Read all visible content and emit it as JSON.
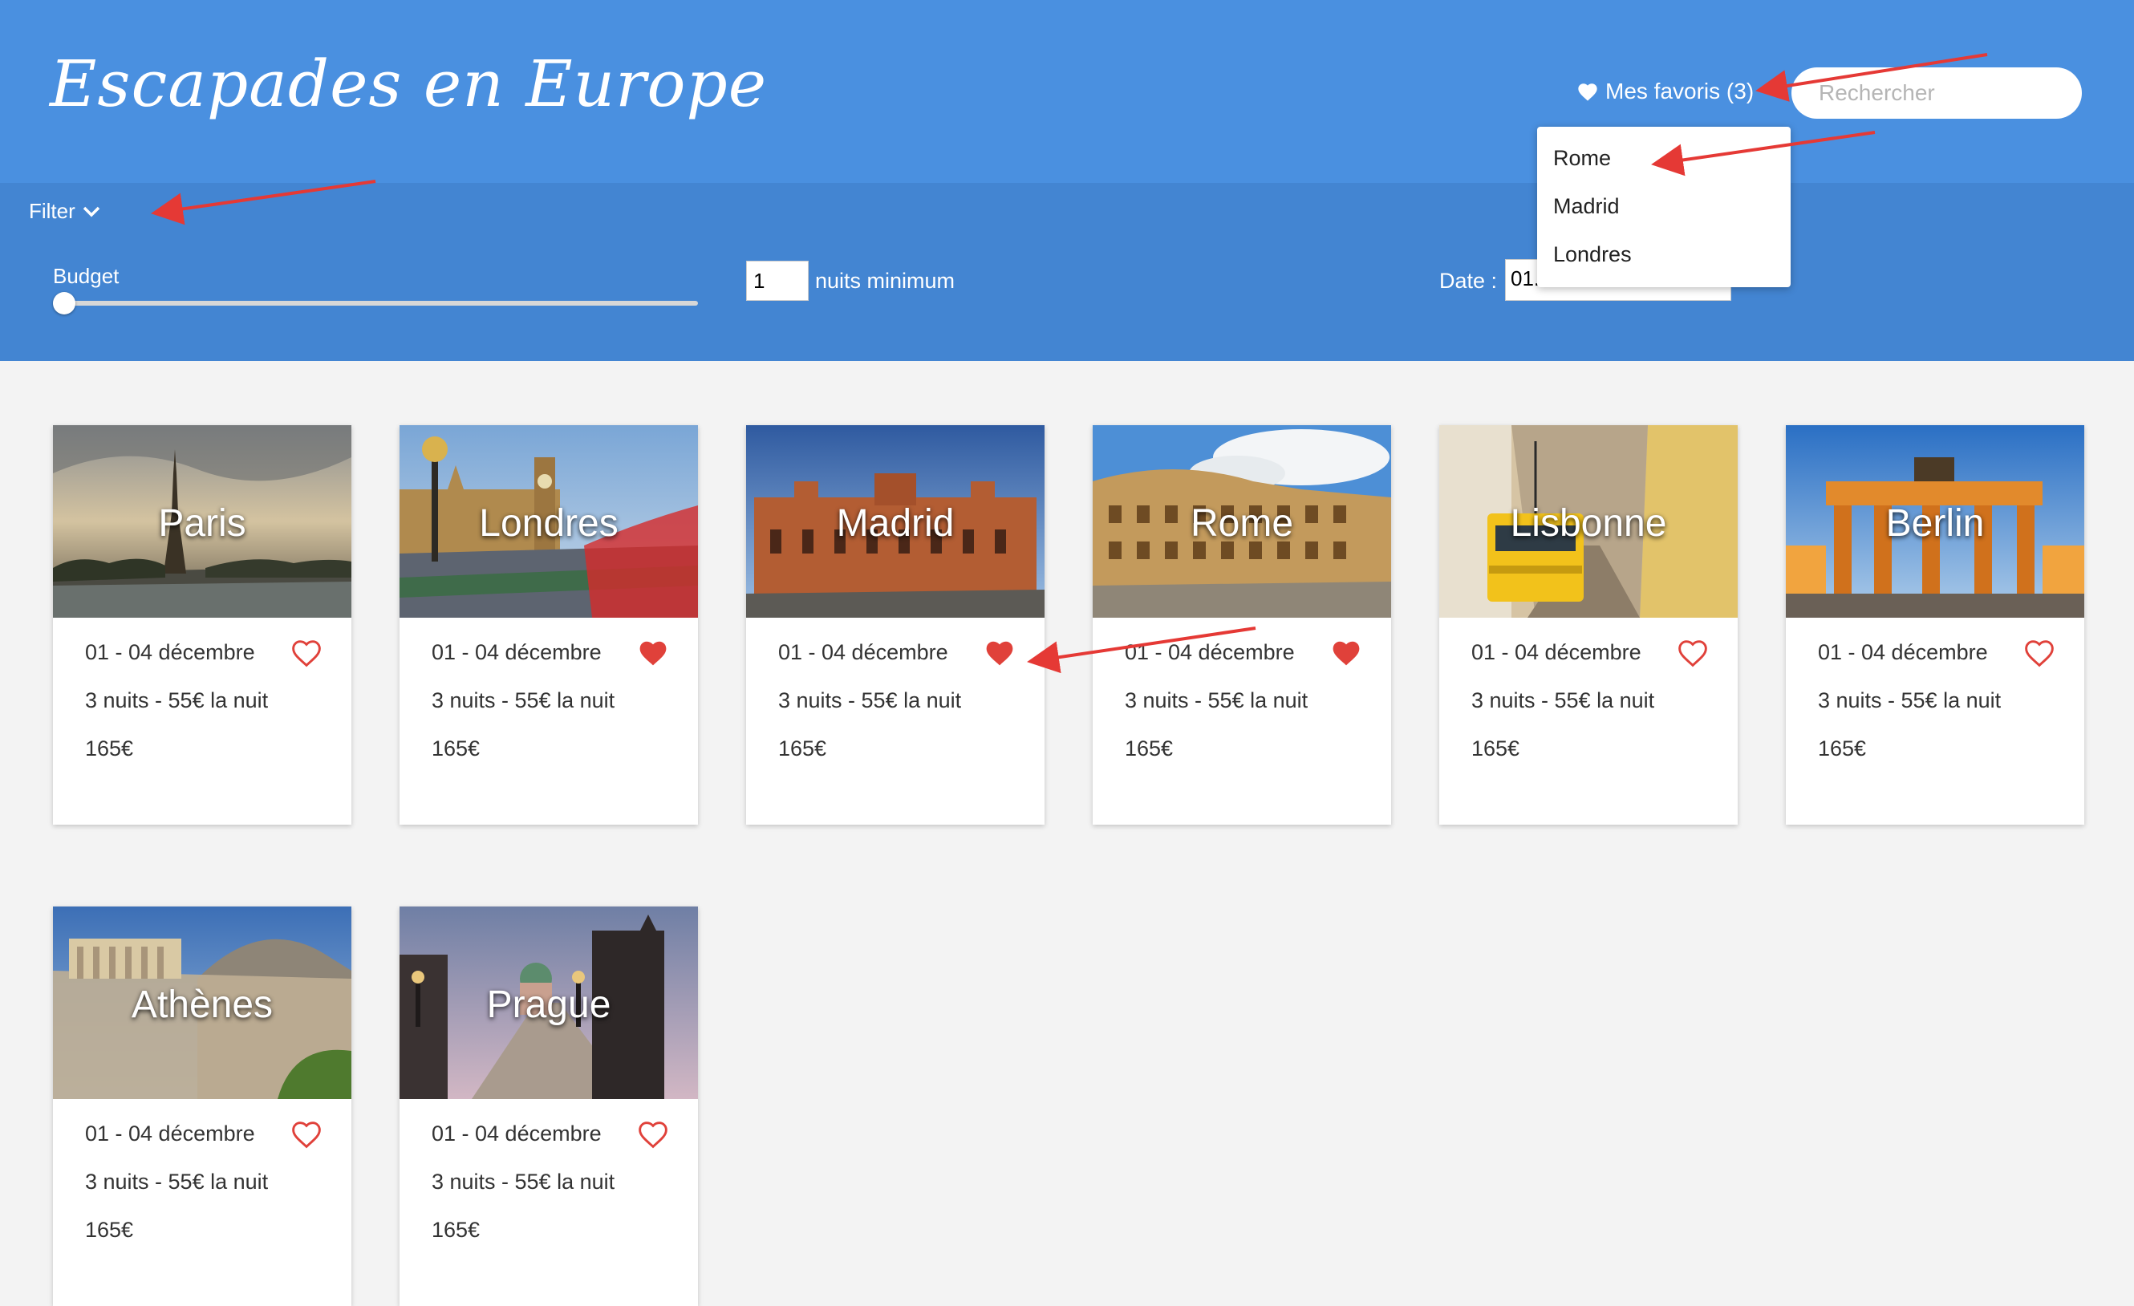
{
  "header": {
    "title": "Escapades en Europe",
    "favorites_label": "Mes favoris (3)",
    "search_placeholder": "Rechercher"
  },
  "filter": {
    "toggle_label": "Filter",
    "budget_label": "Budget",
    "budget_value": 0,
    "nights_value": "1",
    "nights_label": "nuits minimum",
    "date_label": "Date :",
    "date_value": "01.12.2018"
  },
  "favorites_menu": [
    "Rome",
    "Madrid",
    "Londres"
  ],
  "colors": {
    "header": "#4a90e0",
    "filterbar": "#4385d2",
    "heart": "#e0413a"
  },
  "cards": [
    {
      "city": "Paris",
      "dates": "01 - 04 décembre",
      "nights": "3 nuits - 55€ la nuit",
      "price": "165€",
      "favorite": false
    },
    {
      "city": "Londres",
      "dates": "01 - 04 décembre",
      "nights": "3 nuits - 55€ la nuit",
      "price": "165€",
      "favorite": true
    },
    {
      "city": "Madrid",
      "dates": "01 - 04 décembre",
      "nights": "3 nuits - 55€ la nuit",
      "price": "165€",
      "favorite": true
    },
    {
      "city": "Rome",
      "dates": "01 - 04 décembre",
      "nights": "3 nuits - 55€ la nuit",
      "price": "165€",
      "favorite": true
    },
    {
      "city": "Lisbonne",
      "dates": "01 - 04 décembre",
      "nights": "3 nuits - 55€ la nuit",
      "price": "165€",
      "favorite": false
    },
    {
      "city": "Berlin",
      "dates": "01 - 04 décembre",
      "nights": "3 nuits - 55€ la nuit",
      "price": "165€",
      "favorite": false
    },
    {
      "city": "Athènes",
      "dates": "01 - 04 décembre",
      "nights": "3 nuits - 55€ la nuit",
      "price": "165€",
      "favorite": false
    },
    {
      "city": "Prague",
      "dates": "01 - 04 décembre",
      "nights": "3 nuits - 55€ la nuit",
      "price": "165€",
      "favorite": false
    }
  ]
}
